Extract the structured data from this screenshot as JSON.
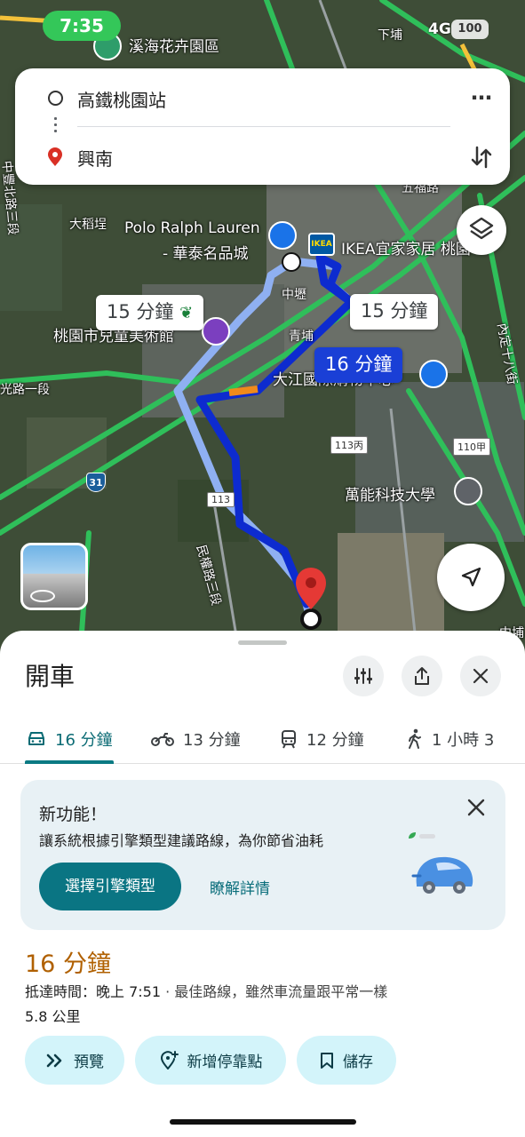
{
  "status_bar": {
    "time": "7:35",
    "network": "4G",
    "battery": "100"
  },
  "search": {
    "origin": "高鐵桃園站",
    "destination": "興南"
  },
  "map": {
    "labels": {
      "flower_garden": "溪海花卉園區",
      "xiapu": "下埔",
      "dadaopi": "大稻埕",
      "polo_name": "Polo Ralph Lauren",
      "polo_sub": "- 華泰名品城",
      "ikea": "IKEA宜家家居 桃園",
      "zhongli": "中壢",
      "museum": "桃園市兒童美術館",
      "qingpu": "青埔",
      "dajiang": "大江國際購物中心",
      "vanung": "萬能科技大學",
      "wuhe": "五福路",
      "road_left": "光路一段",
      "road_left2": "中豐北路三段",
      "minquan": "民權路三段",
      "neidong": "內定十八街",
      "zhongyi": "中埔"
    },
    "road_signs": {
      "r113a": "113丙",
      "r113": "113",
      "r110": "110甲",
      "r31": "31"
    },
    "route_labels": {
      "alt_left": "15 分鐘",
      "alt_right": "15 分鐘",
      "main": "16 分鐘"
    }
  },
  "sheet": {
    "title": "開車",
    "modes": [
      {
        "icon": "car-icon",
        "label": "16 分鐘"
      },
      {
        "icon": "motorcycle-icon",
        "label": "13 分鐘"
      },
      {
        "icon": "train-icon",
        "label": "12 分鐘"
      },
      {
        "icon": "walk-icon",
        "label": "1 小時 3"
      }
    ],
    "promo": {
      "title": "新功能！",
      "description": "讓系統根據引擎類型建議路線，為你節省油耗",
      "primary_button": "選擇引擎類型",
      "link": "瞭解詳情"
    },
    "trip": {
      "duration": "16 分鐘",
      "arrival": "抵達時間：晚上 7:51",
      "note": "· 最佳路線，雖然車流量跟平常一樣",
      "distance": "5.8 公里"
    },
    "actions": {
      "preview": "預覽",
      "add_stop": "新增停靠點",
      "save": "儲存"
    }
  },
  "colors": {
    "main_route": "#1a3fd6",
    "alt_route": "#8fb0f2",
    "accent": "#0a7583",
    "duration": "#b06000",
    "pin": "#e53935"
  }
}
